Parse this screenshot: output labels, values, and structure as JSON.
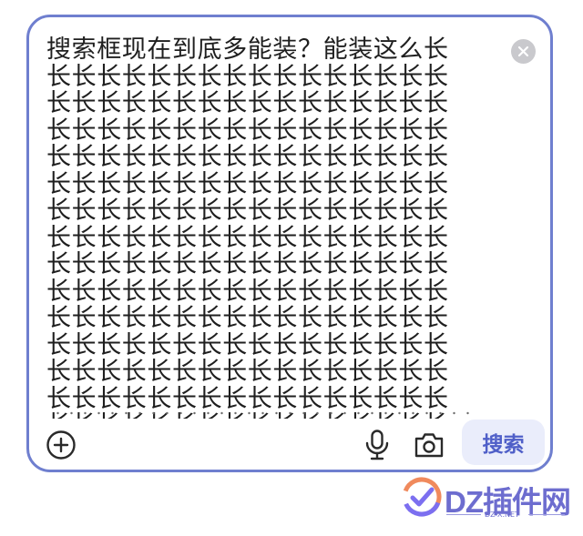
{
  "search": {
    "lines": [
      "搜索框现在到底多能装？能装这么长",
      "长长长长长长长长长长长长长长长长",
      "长长长长长长长长长长长长长长长长",
      "长长长长长长长长长长长长长长长长",
      "长长长长长长长长长长长长长长长长",
      "长长长长长长长长长长长长长长长长",
      "长长长长长长长长长长长长长长长长",
      "长长长长长长长长长长长长长长长长",
      "长长长长长长长长长长长长长长长长",
      "长长长长长长长长长长长长长长长长",
      "长长长长长长长长长长长长长长长长",
      "长长长长长长长长长长长长长长长长",
      "长长长长长长长长长长长长长长长长",
      "长长长长长长长长长长长长长长长长",
      "长长长长长长长长长长长长长长长长"
    ],
    "submit_label": "搜索"
  },
  "icons": {
    "clear": "close-circle-icon",
    "add": "plus-circle-icon",
    "voice": "microphone-icon",
    "camera": "camera-icon"
  },
  "watermark": {
    "brand": "DZ插件网",
    "domain": "DZ-X.NET"
  },
  "colors": {
    "border": "#6f7fcf",
    "button_bg": "#eaedfb",
    "button_text": "#4f5fc8"
  }
}
